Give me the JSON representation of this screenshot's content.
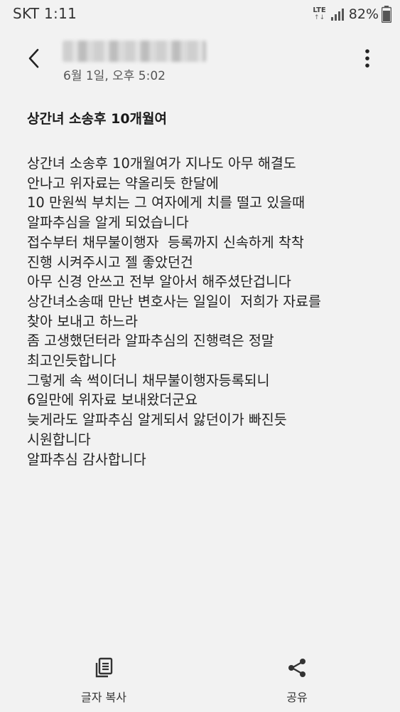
{
  "status_bar": {
    "carrier_time": "SKT 1:11",
    "network": "LTE",
    "network_arrows": "↑↓",
    "battery": "82%"
  },
  "header": {
    "date": "6월 1일, 오후 5:02"
  },
  "message": {
    "subject": "상간녀 소송후 10개월여",
    "lines": [
      "상간녀 소송후 10개월여가 지나도 아무 해결도",
      "안나고 위자료는 약올리듯 한달에",
      "10 만원씩 부치는 그 여자에게 치를 떨고 있을때",
      "알파추심을 알게 되었습니다",
      "접수부터 채무불이행자  등록까지 신속하게 착착",
      "진행 시켜주시고 젤 좋았던건",
      "아무 신경 안쓰고 전부 알아서 해주셨단겁니다",
      "상간녀소송때 만난 변호사는 일일이  저희가 자료를",
      "찾아 보내고 하느라",
      "좀 고생했던터라 알파추심의 진행력은 정말",
      "최고인듯합니다",
      "그렇게 속 썩이더니 채무불이행자등록되니",
      "6일만에 위자료 보내왔더군요",
      "늦게라도 알파추심 알게되서 앓던이가 빠진듯",
      "시원합니다",
      "알파추심 감사합니다"
    ]
  },
  "bottom_bar": {
    "copy_label": "글자 복사",
    "share_label": "공유"
  },
  "icons": {
    "back": "back-arrow-icon",
    "more": "more-vert-icon",
    "copy": "copy-text-icon",
    "share": "share-icon"
  }
}
